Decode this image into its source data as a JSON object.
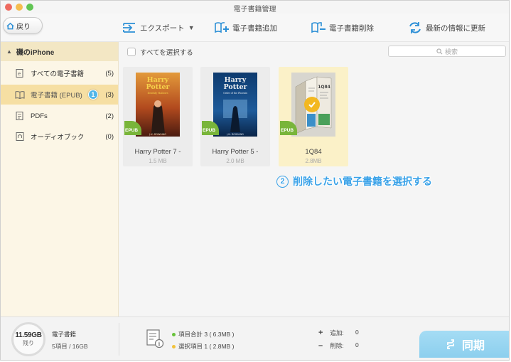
{
  "window": {
    "title": "電子書籍管理"
  },
  "toolbar": {
    "back_label": "戻り",
    "export_label": "エクスポート",
    "add_label": "電子書籍追加",
    "delete_label": "電子書籍削除",
    "refresh_label": "最新の情報に更新"
  },
  "sidebar": {
    "device_name": "磯のiPhone",
    "items": [
      {
        "label": "すべての電子書籍",
        "count": "(5)"
      },
      {
        "label": "電子書籍 (EPUB)",
        "count": "(3)",
        "marker": "1"
      },
      {
        "label": "PDFs",
        "count": "(2)"
      },
      {
        "label": "オーディオブック",
        "count": "(0)"
      }
    ]
  },
  "content": {
    "select_all_label": "すべてを選択する",
    "search_placeholder": "検索",
    "badge_label": "EPUB",
    "books": [
      {
        "title": "Harry Potter 7 -",
        "size": "1.5 MB",
        "selected": false
      },
      {
        "title": "Harry Potter 5 -",
        "size": "2.0 MB",
        "selected": false
      },
      {
        "title": "1Q84",
        "size": "2.8MB",
        "selected": true
      }
    ],
    "cover_text": {
      "hp_title_1": "Harry",
      "hp_title_2": "Potter",
      "hp_subtitle_7": "Deathly Hallows",
      "hp_subtitle_5": "Order of the Phoenix",
      "hp_author": "J.K. ROWLING",
      "q84_title": "1Q84"
    },
    "annotation": {
      "number": "2",
      "text": "削除したい電子書籍を選択する"
    }
  },
  "footer": {
    "free_space": "11.59GB",
    "free_label": "残り",
    "storage_title": "電子書籍",
    "storage_detail": "5項目 / 16GB",
    "total_items": "項目合計 3 ( 6.3MB )",
    "selected_items": "選択項目 1 ( 2.8MB )",
    "add_label": "追加:",
    "add_count": "0",
    "delete_label": "削除:",
    "delete_count": "0",
    "sync_label": "同期"
  },
  "colors": {
    "accent": "#3aa2e8",
    "sidebar_active": "#f6dfa3",
    "epub_badge": "#79b53a",
    "selected_check": "#f3b820",
    "sync_button": "#8ccfee"
  }
}
